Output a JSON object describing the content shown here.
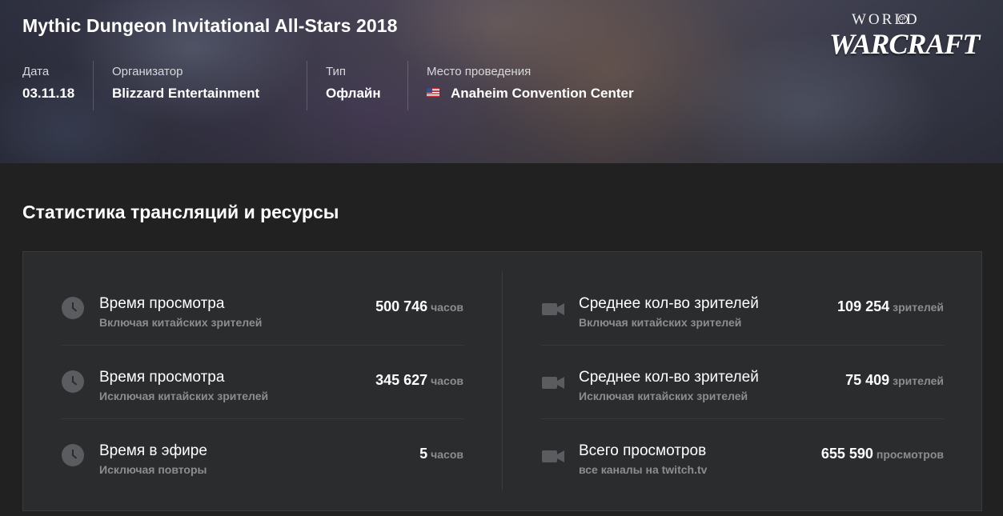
{
  "event": {
    "title": "Mythic Dungeon Invitational All-Stars 2018",
    "game_logo": {
      "line1": "WORLD",
      "of": "OF",
      "line2": "WARCRAFT"
    },
    "meta": [
      {
        "label": "Дата",
        "value": "03.11.18"
      },
      {
        "label": "Организатор",
        "value": "Blizzard Entertainment"
      },
      {
        "label": "Тип",
        "value": "Офлайн"
      },
      {
        "label": "Место проведения",
        "value": "Anaheim Convention Center",
        "flag": "us-flag-icon"
      }
    ]
  },
  "stats": {
    "title": "Статистика трансляций и ресурсы",
    "left": [
      {
        "icon": "clock-icon",
        "name": "Время просмотра",
        "sub": "Включая китайских зрителей",
        "value": "500 746",
        "unit": "часов"
      },
      {
        "icon": "clock-icon",
        "name": "Время просмотра",
        "sub": "Исключая китайских зрителей",
        "value": "345 627",
        "unit": "часов"
      },
      {
        "icon": "clock-icon",
        "name": "Время в эфире",
        "sub": "Исключая повторы",
        "value": "5",
        "unit": "часов"
      }
    ],
    "right": [
      {
        "icon": "video-camera-icon",
        "name": "Среднее кол-во зрителей",
        "sub": "Включая китайских зрителей",
        "value": "109 254",
        "unit": "зрителей"
      },
      {
        "icon": "video-camera-icon",
        "name": "Среднее кол-во зрителей",
        "sub": "Исключая китайских зрителей",
        "value": "75 409",
        "unit": "зрителей"
      },
      {
        "icon": "video-camera-icon",
        "name": "Всего просмотров",
        "sub": "все каналы на twitch.tv",
        "value": "655 590",
        "unit": "просмотров"
      }
    ]
  }
}
